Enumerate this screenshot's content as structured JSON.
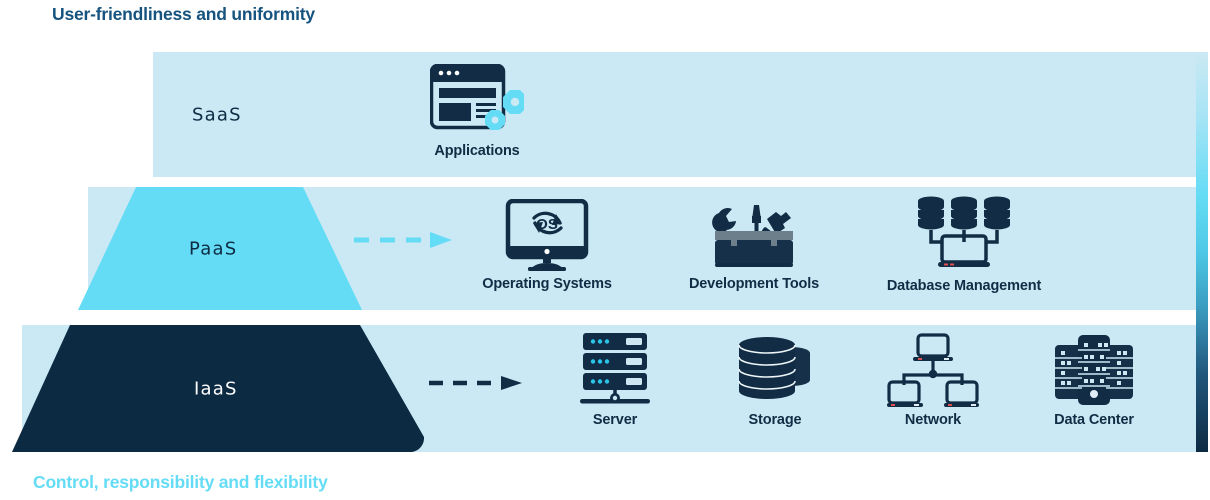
{
  "diagram": {
    "top_caption": "User-friendliness and uniformity",
    "bottom_caption": "Control, responsibility and flexibility",
    "colors": {
      "band_background": "#cbe9f4",
      "saas_shape": "#cbe9f4",
      "paas_shape": "#64dcf5",
      "iaas_shape": "#0d2a43",
      "dark_navy": "#112c44",
      "cyan": "#64dcf5",
      "title_top": "#16537e",
      "title_bottom": "#64dcf5"
    },
    "layers": [
      {
        "id": "saas",
        "label": "SaaS",
        "arrow": null,
        "items": [
          {
            "caption": "Applications",
            "icon": "browser-window-gears-icon"
          }
        ]
      },
      {
        "id": "paas",
        "label": "PaaS",
        "arrow": "dashed-arrow-right-cyan",
        "items": [
          {
            "caption": "Operating Systems",
            "icon": "monitor-os-refresh-icon"
          },
          {
            "caption": "Development Tools",
            "icon": "toolbox-wrench-hammer-icon"
          },
          {
            "caption": "Database Management",
            "icon": "databases-monitor-icon"
          }
        ]
      },
      {
        "id": "iaas",
        "label": "IaaS",
        "arrow": "dashed-arrow-right-navy",
        "items": [
          {
            "caption": "Server",
            "icon": "server-rack-icon"
          },
          {
            "caption": "Storage",
            "icon": "disk-stack-icon"
          },
          {
            "caption": "Network",
            "icon": "network-topology-icon"
          },
          {
            "caption": "Data Center",
            "icon": "data-center-racks-icon"
          }
        ]
      }
    ]
  }
}
